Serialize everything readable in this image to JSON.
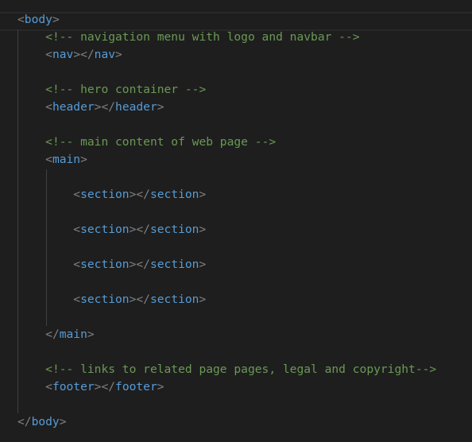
{
  "editor": {
    "language": "html",
    "indent_unit": "    ",
    "colors": {
      "background": "#1e1e1e",
      "tag": "#569cd6",
      "punctuation": "#808080",
      "comment": "#6a9955"
    },
    "lines": [
      {
        "indent": 0,
        "type": "open",
        "tag": "body"
      },
      {
        "indent": 1,
        "type": "comment",
        "text": "<!-- navigation menu with logo and navbar -->"
      },
      {
        "indent": 1,
        "type": "pair",
        "tag": "nav"
      },
      {
        "indent": 0,
        "type": "blank"
      },
      {
        "indent": 1,
        "type": "comment",
        "text": "<!-- hero container -->"
      },
      {
        "indent": 1,
        "type": "pair",
        "tag": "header"
      },
      {
        "indent": 0,
        "type": "blank"
      },
      {
        "indent": 1,
        "type": "comment",
        "text": "<!-- main content of web page -->"
      },
      {
        "indent": 1,
        "type": "open",
        "tag": "main"
      },
      {
        "indent": 0,
        "type": "blank"
      },
      {
        "indent": 2,
        "type": "pair",
        "tag": "section"
      },
      {
        "indent": 0,
        "type": "blank"
      },
      {
        "indent": 2,
        "type": "pair",
        "tag": "section"
      },
      {
        "indent": 0,
        "type": "blank"
      },
      {
        "indent": 2,
        "type": "pair",
        "tag": "section"
      },
      {
        "indent": 0,
        "type": "blank"
      },
      {
        "indent": 2,
        "type": "pair",
        "tag": "section"
      },
      {
        "indent": 0,
        "type": "blank"
      },
      {
        "indent": 1,
        "type": "close",
        "tag": "main"
      },
      {
        "indent": 0,
        "type": "blank"
      },
      {
        "indent": 1,
        "type": "comment",
        "text": "<!-- links to related page pages, legal and copyright-->"
      },
      {
        "indent": 1,
        "type": "pair",
        "tag": "footer"
      },
      {
        "indent": 0,
        "type": "blank"
      },
      {
        "indent": 0,
        "type": "close",
        "tag": "body"
      }
    ]
  }
}
